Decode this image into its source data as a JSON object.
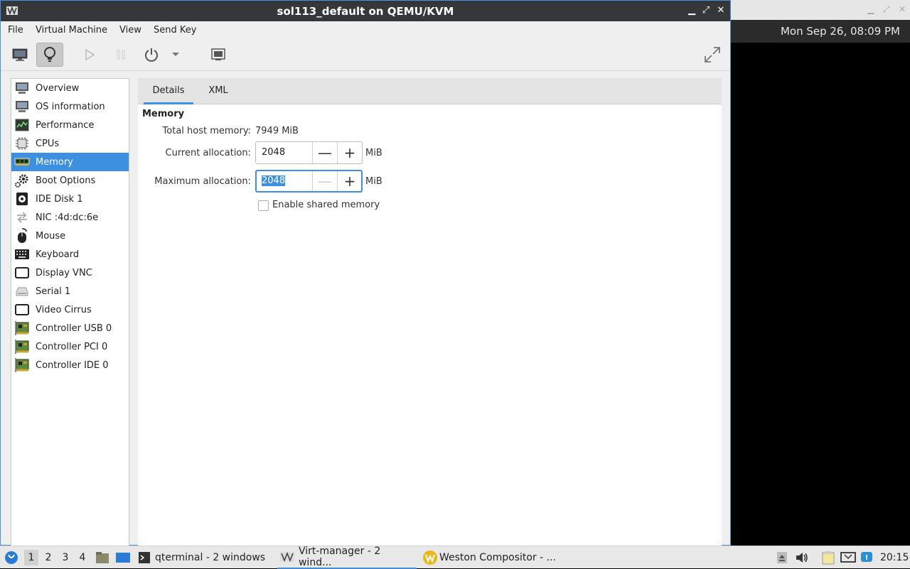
{
  "window": {
    "title": "sol113_default on QEMU/KVM",
    "minimize": "▁",
    "maximize": "⤢",
    "close": "✕"
  },
  "background_window": {
    "clock": "Mon Sep 26, 08:09 PM"
  },
  "menubar": {
    "items": [
      "File",
      "Virtual Machine",
      "View",
      "Send Key"
    ]
  },
  "sidebar": {
    "items": [
      {
        "label": "Overview",
        "icon": "monitor-icon"
      },
      {
        "label": "OS information",
        "icon": "monitor-icon"
      },
      {
        "label": "Performance",
        "icon": "performance-icon"
      },
      {
        "label": "CPUs",
        "icon": "cpu-icon"
      },
      {
        "label": "Memory",
        "icon": "memory-icon",
        "selected": true
      },
      {
        "label": "Boot Options",
        "icon": "gear-icon"
      },
      {
        "label": "IDE Disk 1",
        "icon": "disk-icon"
      },
      {
        "label": "NIC :4d:dc:6e",
        "icon": "network-icon"
      },
      {
        "label": "Mouse",
        "icon": "mouse-icon"
      },
      {
        "label": "Keyboard",
        "icon": "keyboard-icon"
      },
      {
        "label": "Display VNC",
        "icon": "display-icon"
      },
      {
        "label": "Serial 1",
        "icon": "serial-icon"
      },
      {
        "label": "Video Cirrus",
        "icon": "video-icon"
      },
      {
        "label": "Controller USB 0",
        "icon": "controller-icon"
      },
      {
        "label": "Controller PCI 0",
        "icon": "controller-icon"
      },
      {
        "label": "Controller IDE 0",
        "icon": "controller-icon"
      }
    ]
  },
  "tabs": {
    "details": "Details",
    "xml": "XML"
  },
  "memory": {
    "heading": "Memory",
    "total_label": "Total host memory:",
    "total_value": "7949 MiB",
    "current_label": "Current allocation:",
    "current_value": "2048",
    "maximum_label": "Maximum allocation:",
    "maximum_value": "2048",
    "unit": "MiB",
    "shared_label": "Enable shared memory"
  },
  "taskbar": {
    "workspaces": [
      "1",
      "2",
      "3",
      "4"
    ],
    "tasks": [
      {
        "label": "qterminal - 2 windows"
      },
      {
        "label": "Virt-manager - 2 wind..."
      },
      {
        "label": "Weston Compositor - ..."
      }
    ],
    "clock": "20:15"
  },
  "colors": {
    "accent": "#3d8fe0",
    "titlebar": "#36373b"
  }
}
